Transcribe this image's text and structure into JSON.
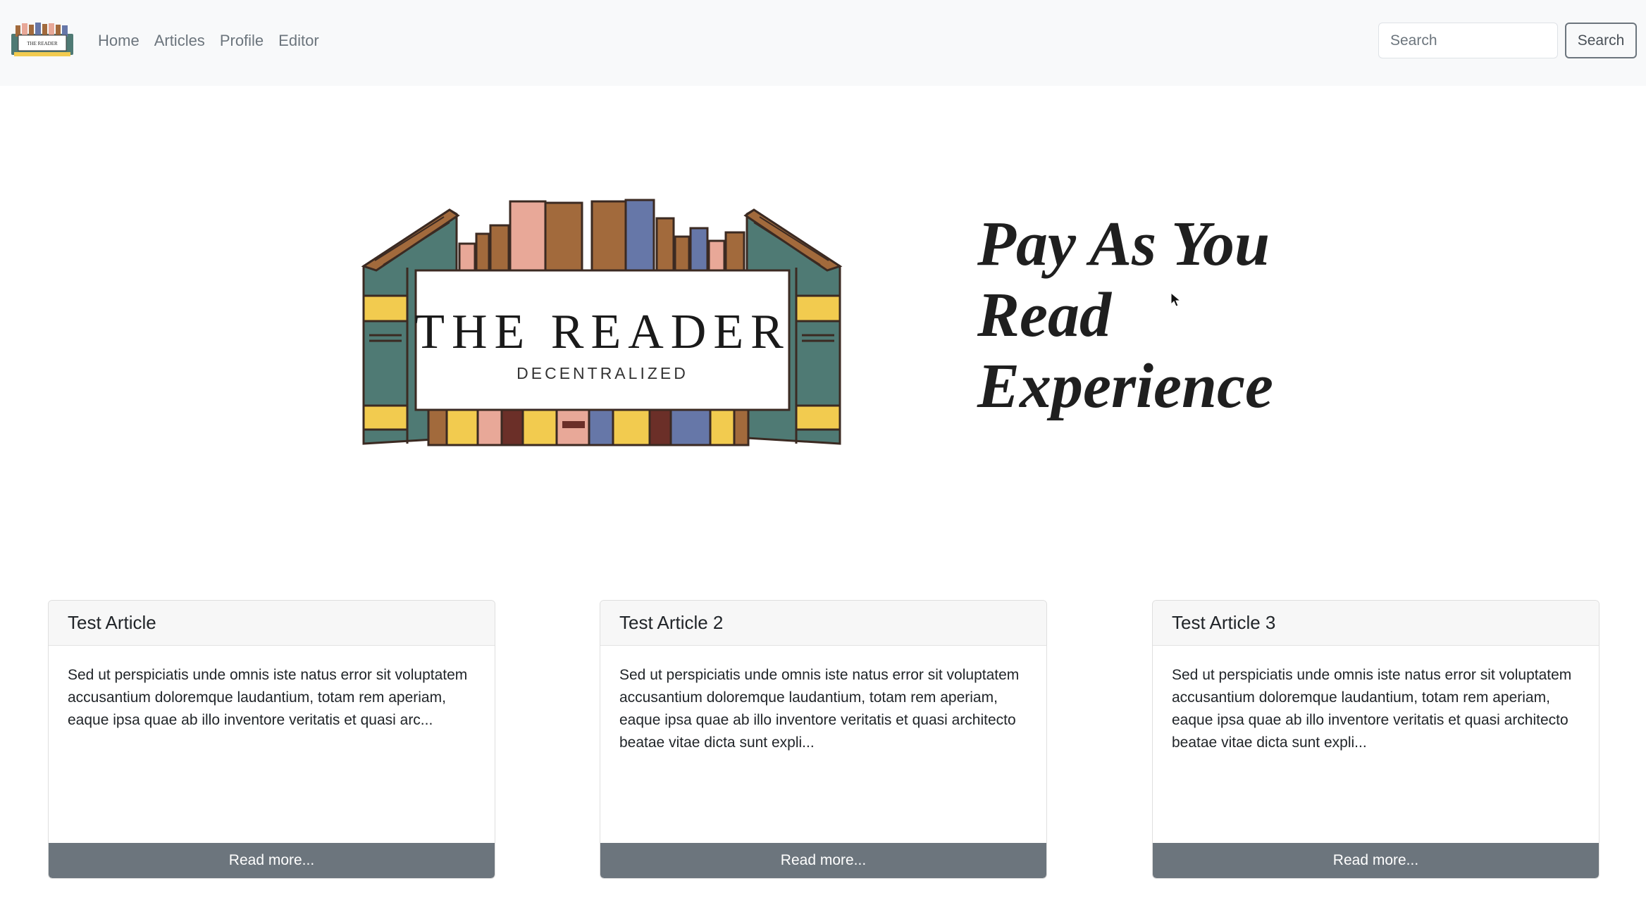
{
  "navbar": {
    "brand_text": "THE READER",
    "links": [
      "Home",
      "Articles",
      "Profile",
      "Editor"
    ],
    "search_placeholder": "Search",
    "search_button": "Search"
  },
  "hero": {
    "logo_title": "THE READER",
    "logo_subtitle": "DECENTRALIZED",
    "tagline_lines": [
      "Pay As You",
      "Read",
      "Experience"
    ]
  },
  "articles": [
    {
      "title": "Test Article",
      "excerpt": "Sed ut perspiciatis unde omnis iste natus error sit voluptatem accusantium doloremque laudantium, totam rem aperiam, eaque ipsa quae ab illo inventore veritatis et quasi arc...",
      "button": "Read more..."
    },
    {
      "title": "Test Article 2",
      "excerpt": "Sed ut perspiciatis unde omnis iste natus error sit voluptatem accusantium doloremque laudantium, totam rem aperiam, eaque ipsa quae ab illo inventore veritatis et quasi architecto beatae vitae dicta sunt expli...",
      "button": "Read more..."
    },
    {
      "title": "Test Article 3",
      "excerpt": "Sed ut perspiciatis unde omnis iste natus error sit voluptatem accusantium doloremque laudantium, totam rem aperiam, eaque ipsa quae ab illo inventore veritatis et quasi architecto beatae vitae dicta sunt expli...",
      "button": "Read more..."
    }
  ],
  "colors": {
    "navbar_bg": "#f8f9fa",
    "card_button": "#6c757d",
    "book_green": "#4f7a74",
    "book_brown": "#a26a3c",
    "book_yellow": "#f2cb4f",
    "book_pink": "#e8a898",
    "book_blue": "#6677a8"
  }
}
